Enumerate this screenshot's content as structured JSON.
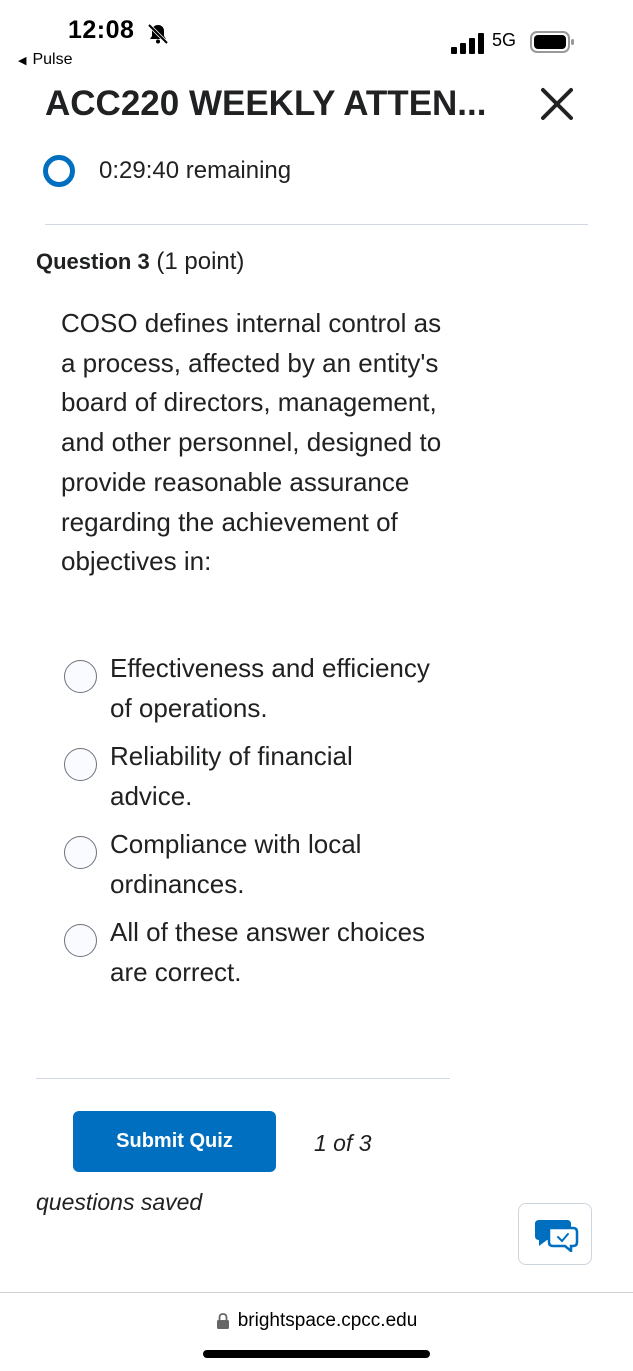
{
  "status_bar": {
    "time": "12:08",
    "back_app": "Pulse",
    "network": "5G"
  },
  "header": {
    "title": "ACC220 WEEKLY ATTEN..."
  },
  "timer": {
    "text": "0:29:40 remaining"
  },
  "question": {
    "number_label": "Question 3",
    "points_label": "(1 point)",
    "text": "COSO defines internal control as a process, affected by an entity's board of directors, management, and other personnel, designed to provide reasonable assurance regarding the achievement of objectives in:",
    "options": [
      {
        "label": "Effectiveness and efficiency of operations."
      },
      {
        "label": "Reliability of financial advice."
      },
      {
        "label": "Compliance with local ordinances."
      },
      {
        "label": "All of these answer choices are correct."
      }
    ]
  },
  "footer": {
    "submit_label": "Submit Quiz",
    "saved_count": "1 of 3",
    "saved_label": "questions saved"
  },
  "browser": {
    "url": "brightspace.cpcc.edu"
  },
  "colors": {
    "accent": "#006fbf",
    "text": "#202122",
    "divider": "#d3d9e3"
  }
}
